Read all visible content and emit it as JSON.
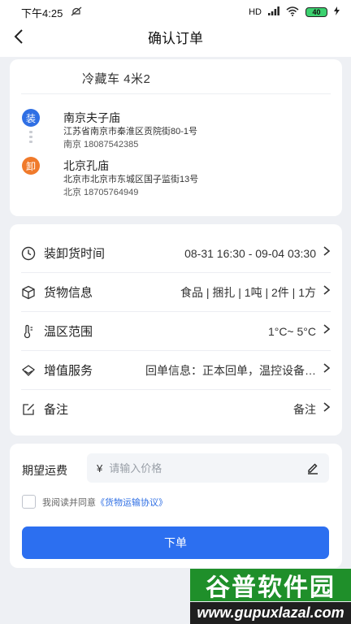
{
  "status_bar": {
    "time": "下午4:25",
    "network": "HD",
    "battery": "40"
  },
  "header": {
    "title": "确认订单"
  },
  "route": {
    "vehicle": "冷藏车  4米2",
    "load": {
      "badge": "装",
      "name": "南京夫子庙",
      "address": "江苏省南京市秦淮区贡院街80-1号",
      "contact": "南京  18087542385"
    },
    "unload": {
      "badge": "卸",
      "name": "北京孔庙",
      "address": "北京市北京市东城区国子监街13号",
      "contact": "北京  18705764949"
    }
  },
  "details": [
    {
      "icon": "clock-icon",
      "label": "装卸货时间",
      "value": "08-31 16:30 - 09-04 03:30"
    },
    {
      "icon": "box-icon",
      "label": "货物信息",
      "value": "食品 | 捆扎 | 1吨 | 2件 | 1方"
    },
    {
      "icon": "thermometer-icon",
      "label": "温区范围",
      "value": "1°C~ 5°C"
    },
    {
      "icon": "diamond-icon",
      "label": "增值服务",
      "value": "回单信息：正本回单，温控设备…"
    },
    {
      "icon": "note-edit-icon",
      "label": "备注",
      "value": "备注"
    }
  ],
  "fee": {
    "label": "期望运费",
    "currency": "¥",
    "placeholder": "请输入价格"
  },
  "agreement": {
    "text": "我阅读并同意",
    "link": "《货物运输协议》",
    "checked": false
  },
  "submit": {
    "label": "下单"
  },
  "watermark": {
    "title": "谷普软件园",
    "url": "www.gupuxlazal.com"
  },
  "colors": {
    "primary": "#2c6ff0",
    "load_badge": "#2f6fe4",
    "unload_badge": "#f07a2b",
    "background": "#eef0f4"
  }
}
